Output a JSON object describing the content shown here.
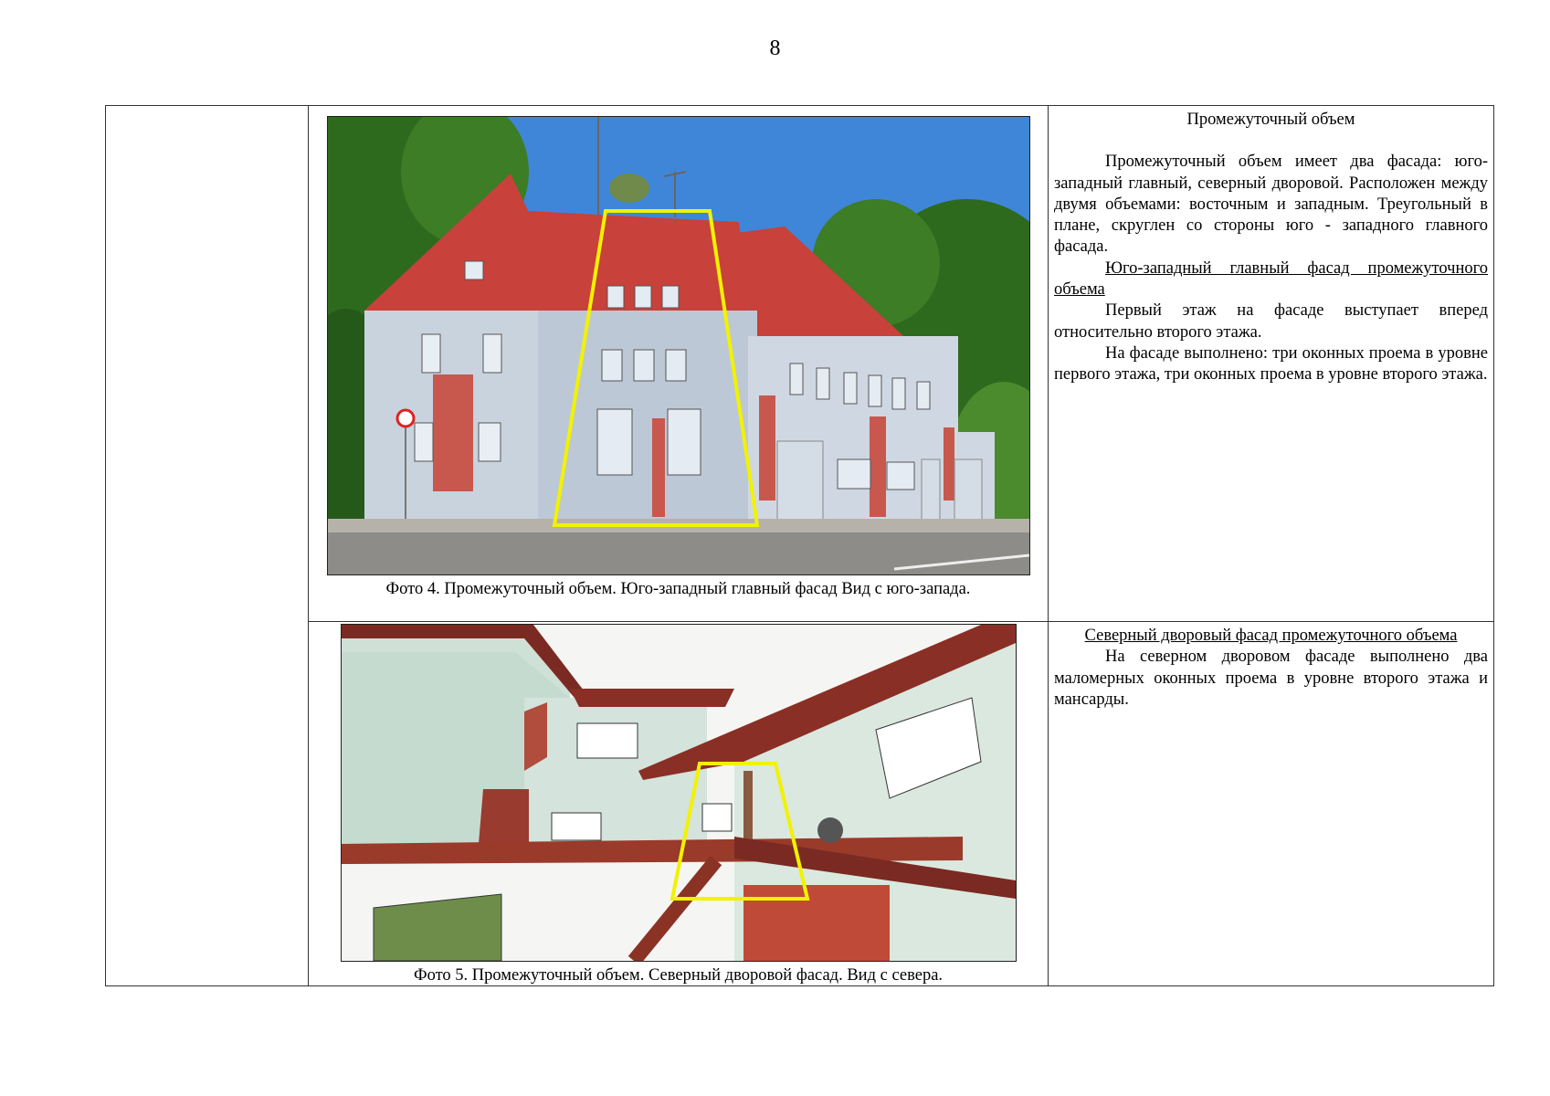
{
  "page": {
    "number": "8"
  },
  "photo4": {
    "caption": "Фото 4.  Промежуточный объем. Юго-западный главный фасад Вид с юго-запада."
  },
  "photo5": {
    "caption": "Фото 5. Промежуточный объем. Северный дворовой фасад. Вид с севера."
  },
  "text1": {
    "heading": "Промежуточный объем",
    "p1": "Промежуточный объем имеет два фасада: юго-западный главный, северный дворовой. Расположен между двумя объемами: восточным и западным. Треугольный в плане, скруглен со стороны юго - западного главного фасада.",
    "subheading": "Юго-западный главный фасад промежуточного объема",
    "p2": "Первый этаж на фасаде выступает вперед относительно второго этажа.",
    "p3": "На фасаде выполнено: три оконных проема в уровне первого этажа, три оконных проема в уровне второго этажа."
  },
  "text2": {
    "subheading": "Северный дворовый фасад промежуточного объема",
    "p1": "На северном дворовом фасаде выполнено два маломерных оконных проема в уровне второго этажа и мансарды."
  },
  "colors": {
    "highlight": "#f2f200",
    "roof": "#c8413a",
    "wall": "#c9d3de",
    "sky": "#3f86d8",
    "trees": "#2e6a1e"
  }
}
